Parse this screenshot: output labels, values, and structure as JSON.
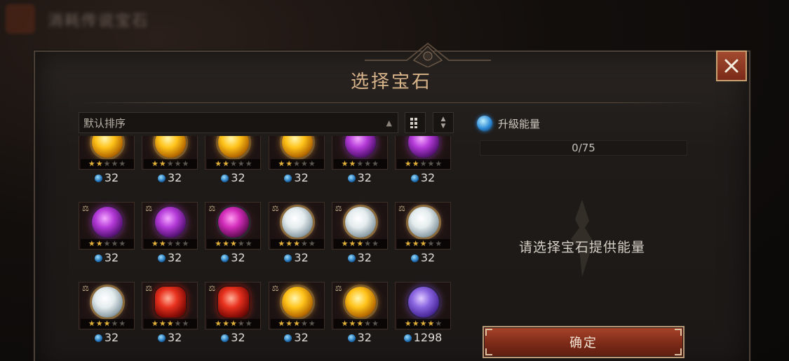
{
  "background": {
    "title": "消耗传说宝石",
    "back_icon": "back-arrow-icon"
  },
  "modal": {
    "title": "选择宝石",
    "close_icon": "close-icon"
  },
  "sort": {
    "selected": "默认排序",
    "arrow_icon": "triangle-up-icon",
    "grid_toggle_icon": "grid-view-icon",
    "order_toggle_icon": "sort-order-icon"
  },
  "gems": [
    {
      "type": "gold",
      "stars": 2,
      "value": "32",
      "scale": false
    },
    {
      "type": "gold",
      "stars": 2,
      "value": "32",
      "scale": false
    },
    {
      "type": "gold",
      "stars": 2,
      "value": "32",
      "scale": false
    },
    {
      "type": "gold",
      "stars": 2,
      "value": "32",
      "scale": false
    },
    {
      "type": "amethyst",
      "stars": 2,
      "value": "32",
      "scale": false
    },
    {
      "type": "amethyst",
      "stars": 2,
      "value": "32",
      "scale": false
    },
    {
      "type": "amethyst",
      "stars": 2,
      "value": "32",
      "scale": true
    },
    {
      "type": "amethyst",
      "stars": 2,
      "value": "32",
      "scale": true
    },
    {
      "type": "dark-amethyst",
      "stars": 3,
      "value": "32",
      "scale": true
    },
    {
      "type": "pearl",
      "stars": 3,
      "value": "32",
      "scale": true
    },
    {
      "type": "pearl",
      "stars": 3,
      "value": "32",
      "scale": true
    },
    {
      "type": "pearl",
      "stars": 3,
      "value": "32",
      "scale": true
    },
    {
      "type": "pearl",
      "stars": 3,
      "value": "32",
      "scale": true
    },
    {
      "type": "ruby",
      "stars": 3,
      "value": "32",
      "scale": true
    },
    {
      "type": "ruby",
      "stars": 3,
      "value": "32",
      "scale": true
    },
    {
      "type": "gold",
      "stars": 3,
      "value": "32",
      "scale": true
    },
    {
      "type": "gold",
      "stars": 3,
      "value": "32",
      "scale": true
    },
    {
      "type": "violet-orb",
      "stars": 4,
      "value": "1298",
      "scale": false
    }
  ],
  "max_stars": 5,
  "upgrade": {
    "label": "升級能量",
    "progress": "0/75",
    "progress_value": 0,
    "progress_max": 75,
    "icon": "energy-orb-icon"
  },
  "hint": "请选择宝石提供能量",
  "confirm_label": "确定",
  "colors": {
    "accent_title": "#d8b48a",
    "button_red": "#7c2a18",
    "star_on": "#e3b13a",
    "star_off": "#5b5650"
  }
}
